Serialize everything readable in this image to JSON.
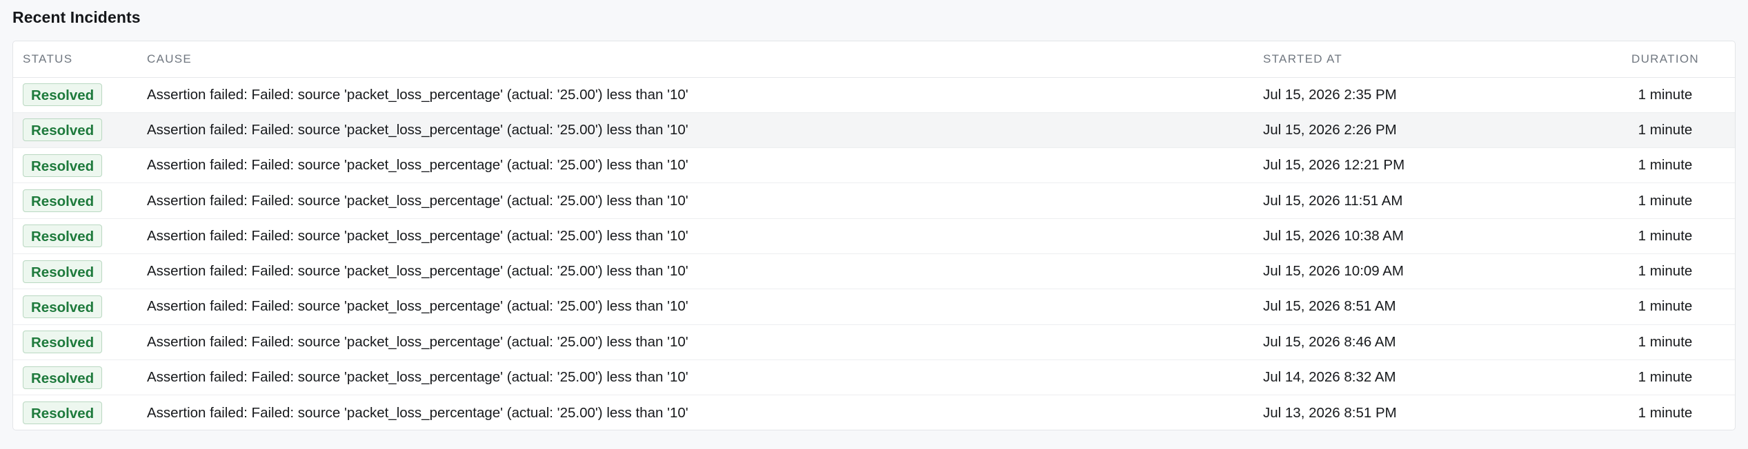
{
  "section": {
    "title": "Recent Incidents"
  },
  "table": {
    "headers": {
      "status": "STATUS",
      "cause": "CAUSE",
      "started_at": "STARTED AT",
      "duration": "DURATION"
    },
    "rows": [
      {
        "status": "Resolved",
        "cause": "Assertion failed: Failed: source 'packet_loss_percentage' (actual: '25.00') less than '10'",
        "started_at": "Jul 15, 2026 2:35 PM",
        "duration": "1 minute"
      },
      {
        "status": "Resolved",
        "cause": "Assertion failed: Failed: source 'packet_loss_percentage' (actual: '25.00') less than '10'",
        "started_at": "Jul 15, 2026 2:26 PM",
        "duration": "1 minute"
      },
      {
        "status": "Resolved",
        "cause": "Assertion failed: Failed: source 'packet_loss_percentage' (actual: '25.00') less than '10'",
        "started_at": "Jul 15, 2026 12:21 PM",
        "duration": "1 minute"
      },
      {
        "status": "Resolved",
        "cause": "Assertion failed: Failed: source 'packet_loss_percentage' (actual: '25.00') less than '10'",
        "started_at": "Jul 15, 2026 11:51 AM",
        "duration": "1 minute"
      },
      {
        "status": "Resolved",
        "cause": "Assertion failed: Failed: source 'packet_loss_percentage' (actual: '25.00') less than '10'",
        "started_at": "Jul 15, 2026 10:38 AM",
        "duration": "1 minute"
      },
      {
        "status": "Resolved",
        "cause": "Assertion failed: Failed: source 'packet_loss_percentage' (actual: '25.00') less than '10'",
        "started_at": "Jul 15, 2026 10:09 AM",
        "duration": "1 minute"
      },
      {
        "status": "Resolved",
        "cause": "Assertion failed: Failed: source 'packet_loss_percentage' (actual: '25.00') less than '10'",
        "started_at": "Jul 15, 2026 8:51 AM",
        "duration": "1 minute"
      },
      {
        "status": "Resolved",
        "cause": "Assertion failed: Failed: source 'packet_loss_percentage' (actual: '25.00') less than '10'",
        "started_at": "Jul 15, 2026 8:46 AM",
        "duration": "1 minute"
      },
      {
        "status": "Resolved",
        "cause": "Assertion failed: Failed: source 'packet_loss_percentage' (actual: '25.00') less than '10'",
        "started_at": "Jul 14, 2026 8:32 AM",
        "duration": "1 minute"
      },
      {
        "status": "Resolved",
        "cause": "Assertion failed: Failed: source 'packet_loss_percentage' (actual: '25.00') less than '10'",
        "started_at": "Jul 13, 2026 8:51 PM",
        "duration": "1 minute"
      }
    ]
  },
  "colors": {
    "resolved_text": "#1e7a3c",
    "resolved_bg": "#edf7ef",
    "resolved_border": "#b9d8c1",
    "highlighted_row_bg": "#f4f5f6"
  }
}
